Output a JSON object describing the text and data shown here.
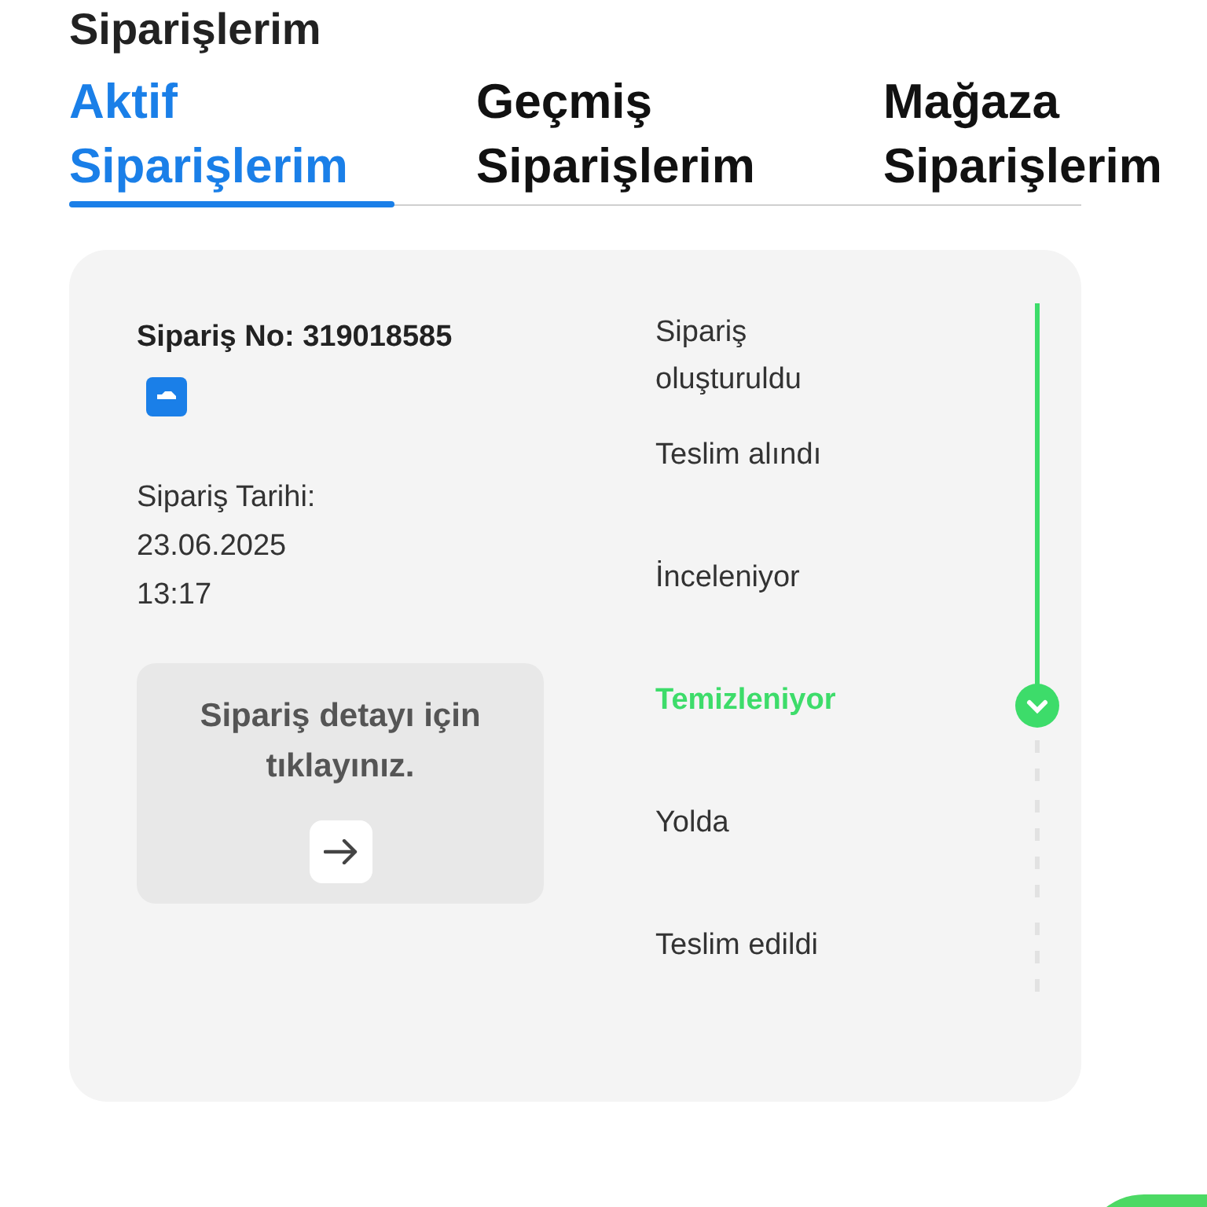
{
  "page_title": "Siparişlerim",
  "tabs": [
    {
      "line1": "Aktif",
      "line2": "Siparişlerim",
      "selected": true
    },
    {
      "line1": "Geçmiş",
      "line2": "Siparişlerim",
      "selected": false
    },
    {
      "line1": "Mağaza",
      "line2": "Siparişlerim",
      "selected": false
    }
  ],
  "order": {
    "number_label": "Sipariş No: 319018585",
    "date_label": "Sipariş Tarihi:",
    "date": "23.06.2025",
    "time": "13:17",
    "detail_text": "Sipariş detayı için tıklayınız."
  },
  "steps": [
    {
      "label": "Sipariş oluşturuldu",
      "done": true,
      "current": false
    },
    {
      "label": "Teslim alındı",
      "done": true,
      "current": false
    },
    {
      "label": "İnceleniyor",
      "done": true,
      "current": false
    },
    {
      "label": "Temizleniyor",
      "done": false,
      "current": true
    },
    {
      "label": "Yolda",
      "done": false,
      "current": false
    },
    {
      "label": "Teslim edildi",
      "done": false,
      "current": false
    }
  ]
}
